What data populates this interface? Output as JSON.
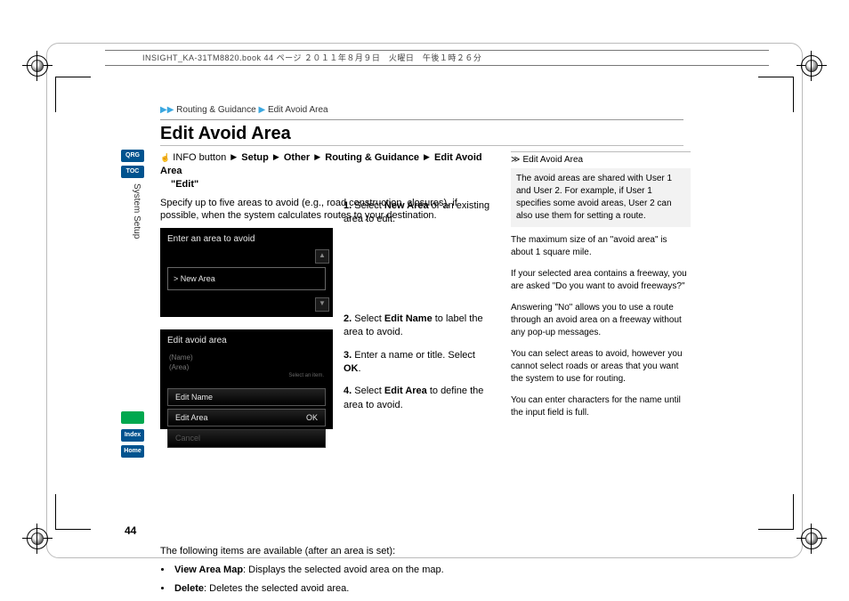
{
  "header_book_info": "INSIGHT_KA-31TM8820.book  44 ページ  ２０１１年８月９日　火曜日　午後１時２６分",
  "breadcrumb": {
    "a": "Routing & Guidance",
    "b": "Edit Avoid Area"
  },
  "section_title": "Edit Avoid Area",
  "side_tabs": {
    "qrg": "QRG",
    "toc": "TOC",
    "voice": "",
    "index": "Index",
    "home": "Home"
  },
  "vertical_label": "System Setup",
  "path": {
    "lead": "INFO button",
    "p1": "Setup",
    "p2": "Other",
    "p3": "Routing & Guidance",
    "p4": "Edit Avoid Area",
    "p5": "\"Edit\""
  },
  "spec": "Specify up to five areas to avoid (e.g., road construction, closures), if possible, when the system calculates routes to your destination.",
  "screen1": {
    "title": "Enter an area to avoid",
    "row": "> New Area"
  },
  "screen2": {
    "title": "Edit avoid area",
    "meta1": "(Name)",
    "meta2": "(Area)",
    "hint": "Select an item.",
    "b1": "Edit Name",
    "b2": "Edit Area",
    "ok": "OK",
    "b3": "Cancel"
  },
  "steps": {
    "s1a": "1.",
    "s1b": "Select ",
    "s1c": "New Area",
    "s1d": " or an existing area to edit.",
    "s2a": "2.",
    "s2b": "Select ",
    "s2c": "Edit Name",
    "s2d": " to label the area to avoid.",
    "s3a": "3.",
    "s3b": "Enter a name or title. Select ",
    "s3c": "OK",
    "s3d": ".",
    "s4a": "4.",
    "s4b": "Select ",
    "s4c": "Edit Area",
    "s4d": " to define the area to avoid."
  },
  "after": {
    "lead": "The following items are available (after an area is set):",
    "i1a": "View Area Map",
    "i1b": ": Displays the selected avoid area on the map.",
    "i2a": "Delete",
    "i2b": ": Deletes the selected avoid area."
  },
  "right": {
    "hdr": "Edit Avoid Area",
    "p1": "The avoid areas are shared with User 1 and User 2. For example, if User 1 specifies some avoid areas, User 2 can also use them for setting a route.",
    "p2": "The maximum size of an \"avoid area\" is about 1 square mile.",
    "p3": "If your selected area contains a freeway, you are asked \"Do you want to avoid freeways?\"",
    "p4": "Answering \"No\" allows you to use a route through an avoid area on a freeway without any pop-up messages.",
    "p5": "You can select areas to avoid, however you cannot select roads or areas that you want the system to use for routing.",
    "p6": "You can enter characters for the name until the input field is full."
  },
  "page_number": "44"
}
